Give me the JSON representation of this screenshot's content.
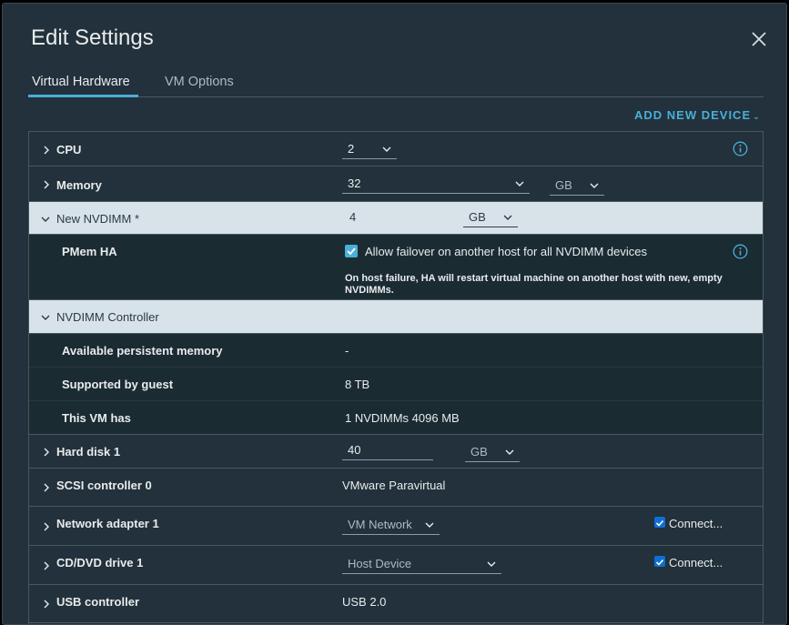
{
  "dialog": {
    "title": "Edit Settings",
    "tabs": [
      {
        "label": "Virtual Hardware",
        "active": true
      },
      {
        "label": "VM Options",
        "active": false
      }
    ],
    "add_device_label": "ADD NEW DEVICE"
  },
  "rows": {
    "cpu": {
      "label": "CPU",
      "value": "2"
    },
    "memory": {
      "label": "Memory",
      "value": "32",
      "unit": "GB"
    },
    "nvdimm": {
      "label": "New NVDIMM *",
      "value": "4",
      "unit": "GB"
    },
    "pmem": {
      "label": "PMem HA",
      "checkbox_label": "Allow failover on another host for all NVDIMM devices",
      "checked": true,
      "note": "On host failure, HA will restart virtual machine on another host with new, empty NVDIMMs."
    },
    "nvdimm_controller": {
      "label": "NVDIMM Controller"
    },
    "available_memory": {
      "label": "Available persistent memory",
      "value": "-"
    },
    "supported_by_guest": {
      "label": "Supported by guest",
      "value": "8 TB"
    },
    "this_vm_has": {
      "label": "This VM has",
      "value": "1 NVDIMMs 4096 MB"
    },
    "hard_disk": {
      "label": "Hard disk 1",
      "value": "40",
      "unit": "GB"
    },
    "scsi": {
      "label": "SCSI controller 0",
      "value": "VMware Paravirtual"
    },
    "network": {
      "label": "Network adapter 1",
      "value": "VM Network",
      "connect_label": "Connect...",
      "connected": true
    },
    "cddvd": {
      "label": "CD/DVD drive 1",
      "value": "Host Device",
      "connect_label": "Connect...",
      "connected": true
    },
    "usb": {
      "label": "USB controller",
      "value": "USB 2.0"
    }
  },
  "colors": {
    "accent": "#49afd9",
    "background": "#22313b",
    "row_highlight": "#d8e3e9",
    "row_dark": "#1b2b32"
  }
}
